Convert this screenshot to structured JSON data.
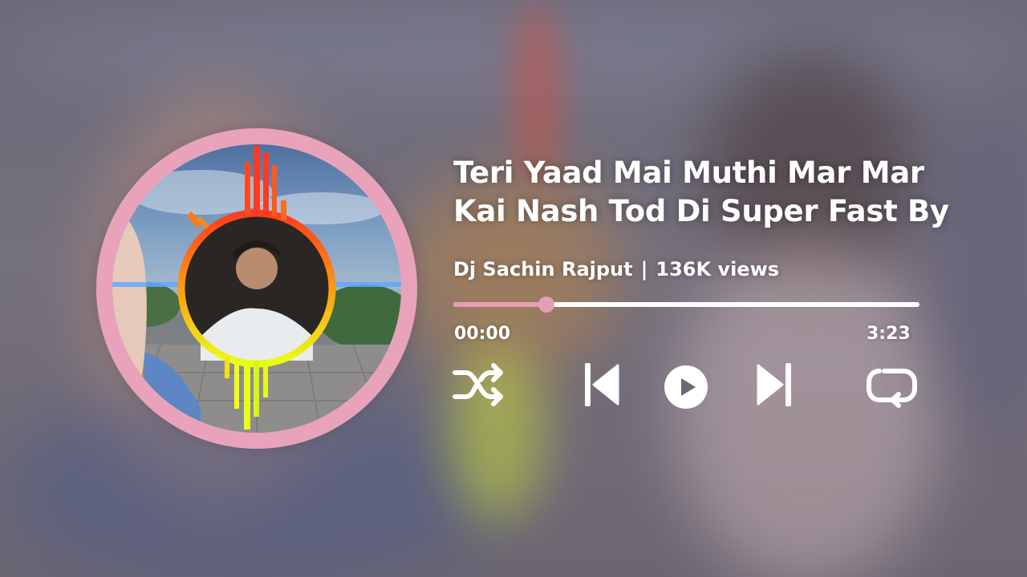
{
  "track": {
    "title_line1": "Teri Yaad Mai Muthi Mar Mar",
    "title_line2": "Kai Nash Tod Di Super Fast By",
    "artist": "Dj Sachin Rajput",
    "separator": "|",
    "views": "136K views"
  },
  "player": {
    "current_time": "00:00",
    "total_time": "3:23",
    "progress": 0.2,
    "accent_color": "#e59fb4",
    "track_color": "#ffffff"
  },
  "controls": {
    "shuffle": "shuffle-icon",
    "previous": "skip-previous-icon",
    "play": "play-icon",
    "next": "skip-next-icon",
    "repeat": "repeat-icon"
  }
}
